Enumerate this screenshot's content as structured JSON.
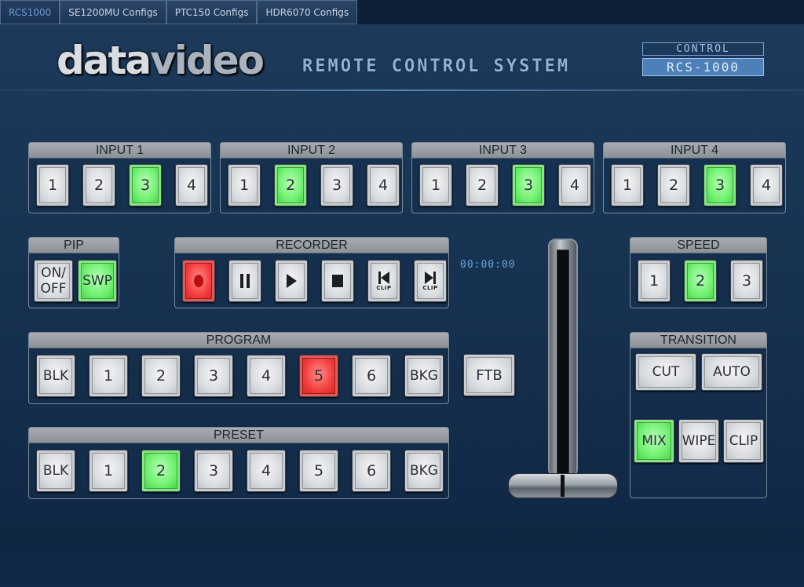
{
  "tabs": [
    {
      "label": "RCS1000",
      "active": true
    },
    {
      "label": "SE1200MU Configs",
      "active": false
    },
    {
      "label": "PTC150 Configs",
      "active": false
    },
    {
      "label": "HDR6070 Configs",
      "active": false
    }
  ],
  "header": {
    "logo_part1": "data",
    "logo_part2": "video",
    "system_title": "REMOTE CONTROL SYSTEM",
    "control_label": "CONTROL",
    "model": "RCS-1000"
  },
  "inputs": [
    {
      "title": "INPUT 1",
      "buttons": [
        "1",
        "2",
        "3",
        "4"
      ],
      "active": "3"
    },
    {
      "title": "INPUT 2",
      "buttons": [
        "1",
        "2",
        "3",
        "4"
      ],
      "active": "2"
    },
    {
      "title": "INPUT 3",
      "buttons": [
        "1",
        "2",
        "3",
        "4"
      ],
      "active": "3"
    },
    {
      "title": "INPUT 4",
      "buttons": [
        "1",
        "2",
        "3",
        "4"
      ],
      "active": "3"
    }
  ],
  "pip": {
    "title": "PIP",
    "on_off_line1": "ON/",
    "on_off_line2": "OFF",
    "swap": "SWP",
    "active": "SWP"
  },
  "recorder": {
    "title": "RECORDER",
    "clip_label": "CLIP",
    "timecode": "00:00:00",
    "recording": true
  },
  "speed": {
    "title": "SPEED",
    "buttons": [
      "1",
      "2",
      "3"
    ],
    "active": "2"
  },
  "program": {
    "title": "PROGRAM",
    "buttons": [
      "BLK",
      "1",
      "2",
      "3",
      "4",
      "5",
      "6",
      "BKG"
    ],
    "active": "5"
  },
  "ftb": {
    "label": "FTB"
  },
  "preset": {
    "title": "PRESET",
    "buttons": [
      "BLK",
      "1",
      "2",
      "3",
      "4",
      "5",
      "6",
      "BKG"
    ],
    "active": "2"
  },
  "transition": {
    "title": "TRANSITION",
    "cut": "CUT",
    "auto": "AUTO",
    "mix": "MIX",
    "wipe": "WIPE",
    "clip": "CLIP",
    "active": "MIX"
  },
  "colors": {
    "active_green": "#6df06d",
    "active_red": "#f23c3c",
    "accent_blue": "#4d7fb8"
  }
}
